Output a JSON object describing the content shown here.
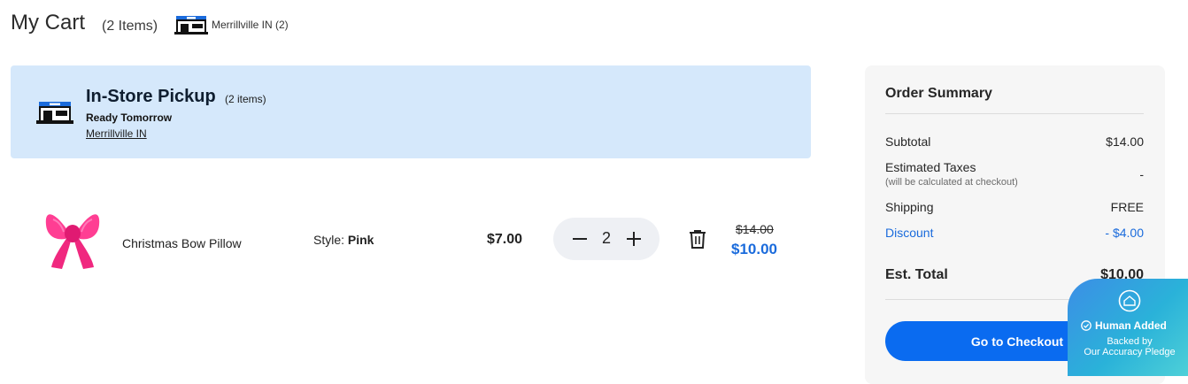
{
  "header": {
    "title": "My Cart",
    "item_count": "(2 Items)",
    "store_label": "Merrillville IN (2)"
  },
  "pickup": {
    "title": "In-Store Pickup",
    "count": "(2 items)",
    "ready": "Ready Tomorrow",
    "location": "Merrillville IN",
    "icon": "store-icon"
  },
  "item": {
    "name": "Christmas Bow Pillow",
    "style_label": "Style:",
    "style_value": "Pink",
    "unit_price": "$7.00",
    "quantity": "2",
    "original_price": "$14.00",
    "sale_price": "$10.00"
  },
  "summary": {
    "title": "Order Summary",
    "subtotal_label": "Subtotal",
    "subtotal_value": "$14.00",
    "taxes_label": "Estimated Taxes",
    "taxes_note": "(will be calculated at checkout)",
    "taxes_value": "-",
    "shipping_label": "Shipping",
    "shipping_value": "FREE",
    "discount_label": "Discount",
    "discount_value": "- $4.00",
    "total_label": "Est. Total",
    "total_value": "$10.00",
    "checkout_label": "Go to Checkout"
  },
  "badge": {
    "title": "Human Added",
    "line1": "Backed by",
    "line2": "Our Accuracy Pledge"
  },
  "colors": {
    "accent": "#0a6bf0",
    "discount": "#1a6bdc",
    "pickup_bg": "#d5e8fb"
  }
}
